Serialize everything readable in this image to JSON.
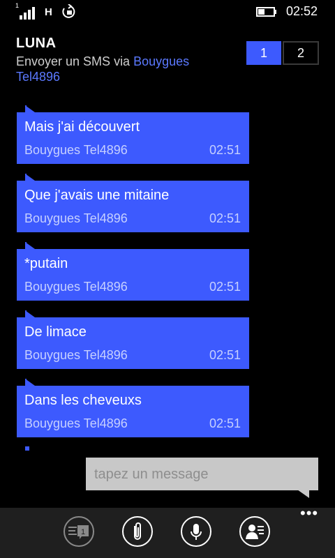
{
  "status_bar": {
    "signal_label": "1",
    "network": "H",
    "time": "02:52"
  },
  "header": {
    "contact_name": "LUNA",
    "send_via_prefix": "Envoyer un SMS via",
    "carrier": "Bouygues Tel4896",
    "pages": [
      "1",
      "2"
    ],
    "active_page": "1"
  },
  "messages": [
    {
      "text": "Mais j'ai découvert",
      "sender": "Bouygues Tel4896",
      "time": "02:51"
    },
    {
      "text": "Que j'avais une mitaine",
      "sender": "Bouygues Tel4896",
      "time": "02:51"
    },
    {
      "text": "*putain",
      "sender": "Bouygues Tel4896",
      "time": "02:51"
    },
    {
      "text": "De limace",
      "sender": "Bouygues Tel4896",
      "time": "02:51"
    },
    {
      "text": "Dans les cheveuxs",
      "sender": "Bouygues Tel4896",
      "time": "02:51"
    }
  ],
  "compose": {
    "placeholder": "tapez un message",
    "value": ""
  },
  "app_bar": {
    "buttons": [
      {
        "icon": "switch-sim-icon",
        "badge": "1"
      },
      {
        "icon": "attach-icon"
      },
      {
        "icon": "microphone-icon"
      },
      {
        "icon": "contact-card-icon"
      }
    ],
    "more_label": "•••"
  },
  "colors": {
    "accent": "#3d5afe",
    "background": "#000000",
    "compose_bg": "#c8c8c8",
    "appbar_bg": "#1f1f1f"
  }
}
